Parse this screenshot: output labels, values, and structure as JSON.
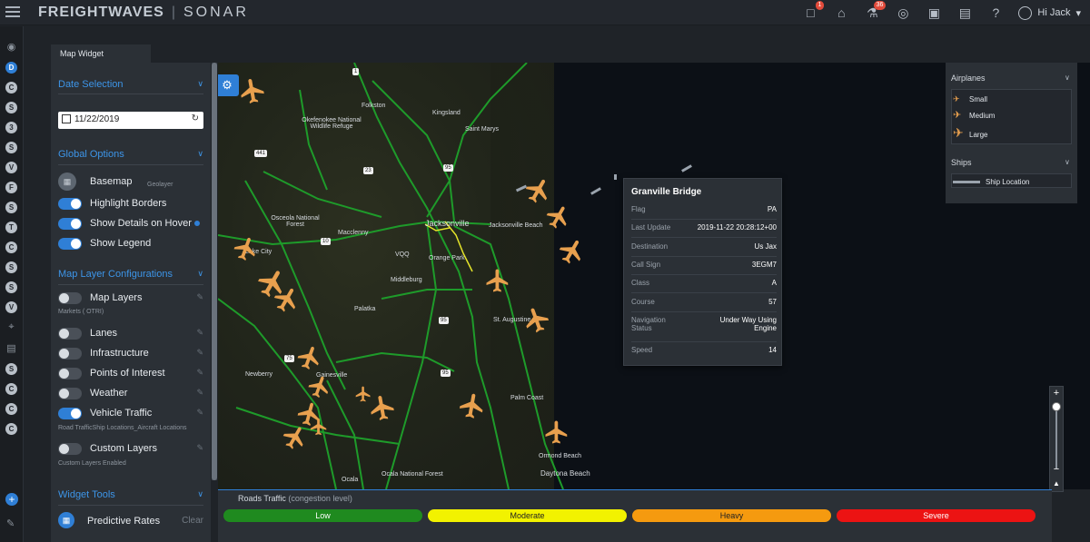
{
  "header": {
    "brand": "FREIGHTWAVES",
    "product": "SONAR",
    "notification_badge": "1",
    "alerts_badge": "36",
    "user_greeting": "Hi Jack"
  },
  "rail": {
    "letters": [
      "D",
      "C",
      "S",
      "3",
      "S",
      "V",
      "F",
      "S",
      "T",
      "C",
      "S",
      "S",
      "V",
      "S",
      "C",
      "C",
      "C"
    ],
    "active_index": 0
  },
  "tab": {
    "label": "Map Widget"
  },
  "panel": {
    "date_selection": {
      "title": "Date Selection",
      "date": "11/22/2019"
    },
    "global_options": {
      "title": "Global Options",
      "basemap_label": "Basemap",
      "basemap_value": "Geolayer",
      "highlight_borders": "Highlight Borders",
      "show_details": "Show Details on Hover",
      "show_legend": "Show Legend"
    },
    "map_layers": {
      "title": "Map Layer Configurations",
      "items": [
        {
          "label": "Map Layers",
          "sub": "Markets ( OTRI)",
          "on": false
        },
        {
          "label": "Lanes",
          "sub": "",
          "on": false
        },
        {
          "label": "Infrastructure",
          "sub": "",
          "on": false
        },
        {
          "label": "Points of Interest",
          "sub": "",
          "on": false
        },
        {
          "label": "Weather",
          "sub": "",
          "on": false
        },
        {
          "label": "Vehicle Traffic",
          "sub": "Road TrafficShip Locations_Aircraft Locations",
          "on": true
        },
        {
          "label": "Custom Layers",
          "sub": "Custom Layers Enabled",
          "on": false
        }
      ]
    },
    "widget_tools": {
      "title": "Widget Tools",
      "predictive_rates": "Predictive Rates",
      "clear": "Clear"
    }
  },
  "map": {
    "labels": [
      "Folkston",
      "Kingsland",
      "Saint Marys",
      "Okefenokee National Wildlife Refuge",
      "Osceola National Forest",
      "Macclenny",
      "Jacksonville",
      "Jacksonville Beach",
      "Orange Park",
      "Middleburg",
      "Lake City",
      "Palatka",
      "St. Augustine",
      "Gainesville",
      "Newberry",
      "Palm Coast",
      "Ocala National Forest",
      "Ormond Beach",
      "Daytona Beach",
      "Ocala",
      "VQQ"
    ]
  },
  "legend": {
    "airplanes_title": "Airplanes",
    "airplanes": [
      "Small",
      "Medium",
      "Large"
    ],
    "ships_title": "Ships",
    "ships": [
      "Ship Location"
    ]
  },
  "tooltip": {
    "title": "Granville Bridge",
    "rows": [
      {
        "k": "Flag",
        "v": "PA"
      },
      {
        "k": "Last Update",
        "v": "2019-11-22 20:28:12+00"
      },
      {
        "k": "Destination",
        "v": "Us Jax"
      },
      {
        "k": "Call Sign",
        "v": "3EGM7"
      },
      {
        "k": "Class",
        "v": "A"
      },
      {
        "k": "Course",
        "v": "57"
      },
      {
        "k": "Navigation Status",
        "v": "Under Way Using Engine"
      },
      {
        "k": "Speed",
        "v": "14"
      }
    ]
  },
  "traffic": {
    "title": "Roads Traffic",
    "subtitle": "(congestion level)",
    "levels": [
      {
        "label": "Low",
        "color": "#1f8a1f",
        "text_color": "#ffffff"
      },
      {
        "label": "Moderate",
        "color": "#f2f200",
        "text_color": "#222222"
      },
      {
        "label": "Heavy",
        "color": "#f59a0f",
        "text_color": "#222222"
      },
      {
        "label": "Severe",
        "color": "#ec1313",
        "text_color": "#ffffff"
      }
    ]
  },
  "zoom": {
    "in": "+",
    "out": "−"
  }
}
